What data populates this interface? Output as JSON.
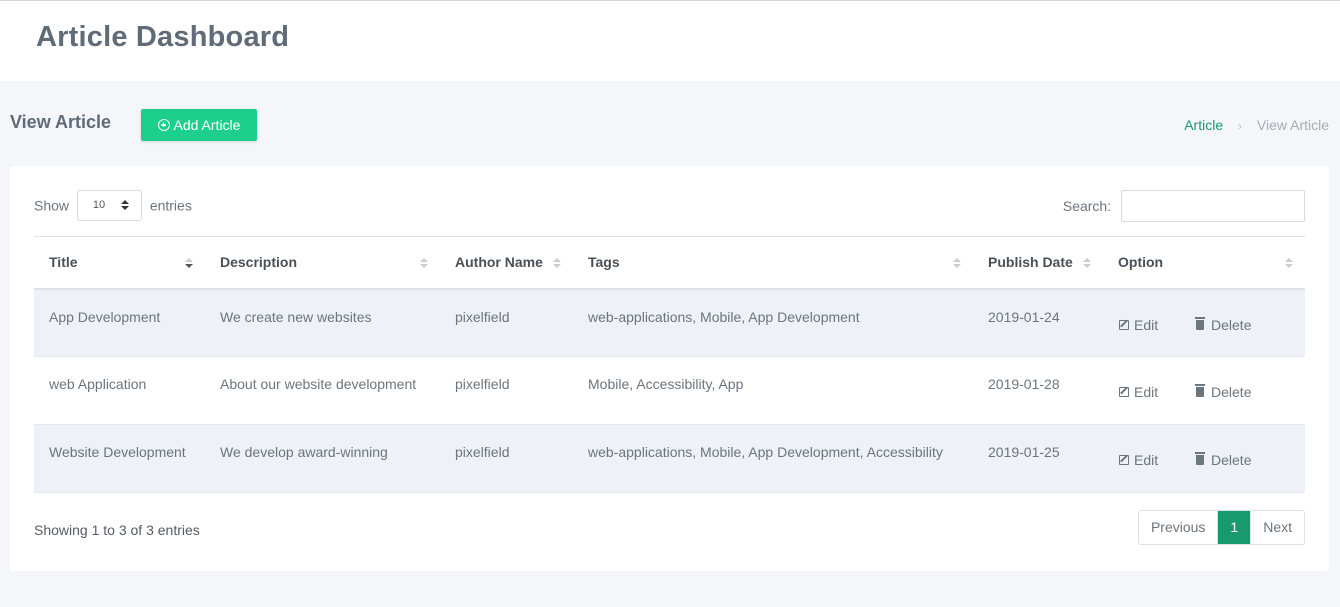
{
  "header": {
    "title": "Article Dashboard"
  },
  "subbar": {
    "page_title": "View Article",
    "add_button": "Add Article",
    "breadcrumb": {
      "link": "Article",
      "separator": "›",
      "current": "View Article"
    }
  },
  "controls": {
    "show_label": "Show",
    "page_length": "10",
    "entries_label": "entries",
    "search_label": "Search:",
    "search_value": ""
  },
  "table": {
    "columns": [
      "Title",
      "Description",
      "Author Name",
      "Tags",
      "Publish Date",
      "Option"
    ],
    "rows": [
      {
        "title": "App Development",
        "description": "We create new websites",
        "author": "pixelfield",
        "tags": "web-applications, Mobile, App Development",
        "date": "2019-01-24"
      },
      {
        "title": "web Application",
        "description": "About our website development",
        "author": "pixelfield",
        "tags": "Mobile, Accessibility, App",
        "date": "2019-01-28"
      },
      {
        "title": "Website Development",
        "description": "We develop award-winning",
        "author": "pixelfield",
        "tags": "web-applications, Mobile, App Development, Accessibility",
        "date": "2019-01-25"
      }
    ],
    "actions": {
      "edit": "Edit",
      "delete": "Delete"
    }
  },
  "footer": {
    "info": "Showing 1 to 3 of 3 entries",
    "pagination": {
      "previous": "Previous",
      "current": "1",
      "next": "Next"
    }
  },
  "colors": {
    "accent": "#1ccf8c",
    "link": "#199a6e",
    "row_stripe": "#eef1f8"
  }
}
